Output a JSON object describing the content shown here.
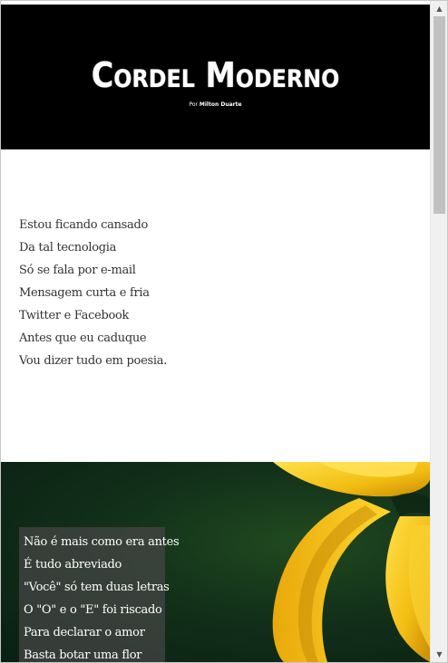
{
  "header": {
    "title": "Cordel Moderno",
    "byline_prefix": "Por",
    "byline_author": "Milton Duarte"
  },
  "stanza1": [
    "Estou ficando cansado",
    "Da tal tecnologia",
    "Só se fala por e-mail",
    "Mensagem curta e fria",
    "Twitter e Facebook",
    "Antes que eu caduque",
    "Vou dizer tudo em poesia."
  ],
  "stanza2": [
    "Não é mais como era antes",
    "É tudo abreviado",
    "\"Você\" só tem duas letras",
    "O \"O\" e o \"E\" foi riscado",
    "Para declarar o amor",
    "Basta botar uma flor"
  ],
  "scrollbar": {
    "up_icon": "▲",
    "down_icon": "▼",
    "position": 0
  },
  "colors": {
    "header_bg": "#000000",
    "photo_bg": "#12301a",
    "flower": "#f2c21b",
    "text_box": "#464646"
  }
}
